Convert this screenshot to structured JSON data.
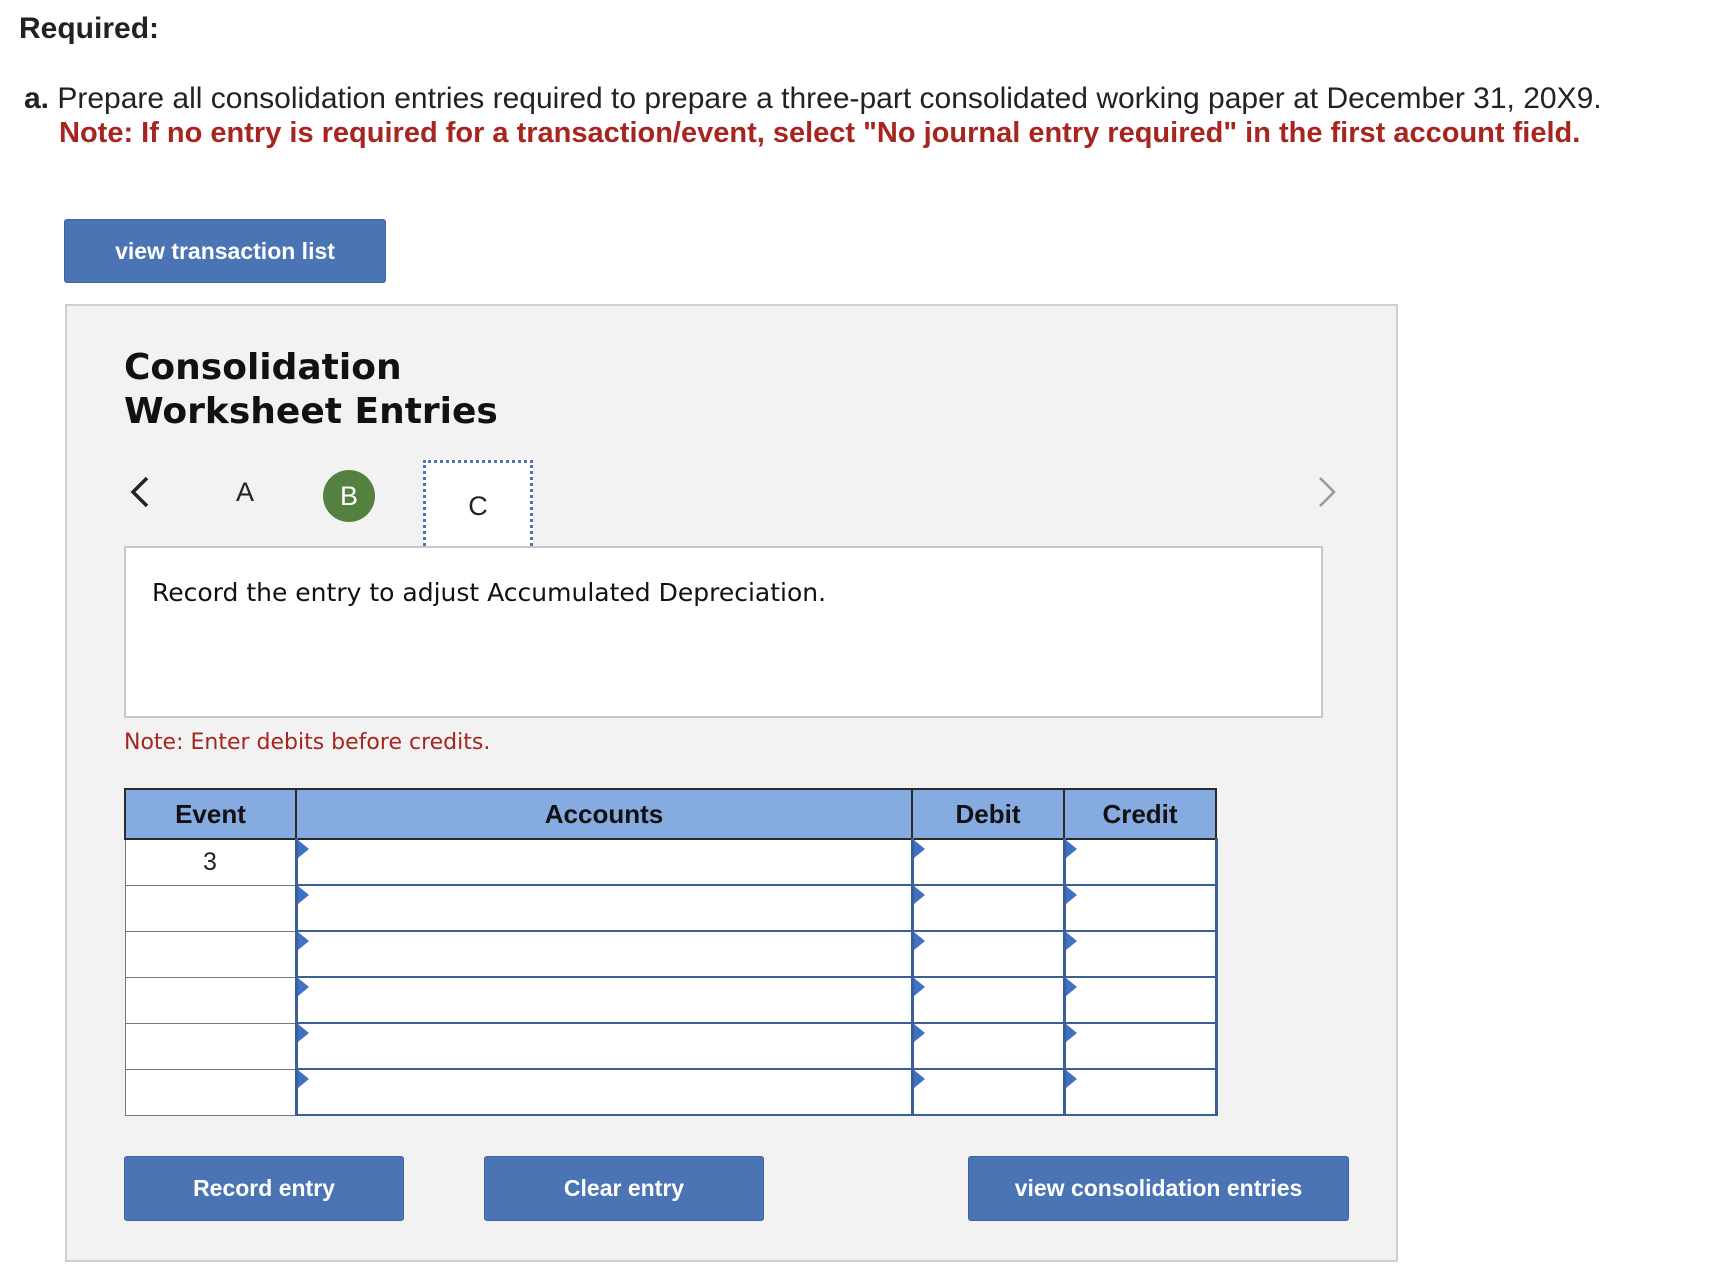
{
  "header": {
    "required": "Required:",
    "question_letter": "a.",
    "question_text": " Prepare all consolidation entries required to prepare a three-part consolidated working paper at December 31, 20X9.",
    "note": "Note: If no entry is required for a transaction/event, select \"No journal entry required\" in the first account field."
  },
  "buttons": {
    "view_transaction_list": "view transaction list",
    "record_entry": "Record entry",
    "clear_entry": "Clear entry",
    "view_consolidation_entries": "view consolidation entries"
  },
  "panel": {
    "title_line1": "Consolidation",
    "title_line2": "Worksheet Entries",
    "tabs": [
      {
        "label": "A",
        "state": "default"
      },
      {
        "label": "B",
        "state": "completed"
      },
      {
        "label": "C",
        "state": "active"
      }
    ],
    "prompt": "Record the entry to adjust Accumulated Depreciation.",
    "note": "Note: Enter debits before credits."
  },
  "journal_table": {
    "headers": [
      "Event",
      "Accounts",
      "Debit",
      "Credit"
    ],
    "rows": [
      {
        "event": "3",
        "account": "",
        "debit": "",
        "credit": ""
      },
      {
        "event": "",
        "account": "",
        "debit": "",
        "credit": ""
      },
      {
        "event": "",
        "account": "",
        "debit": "",
        "credit": ""
      },
      {
        "event": "",
        "account": "",
        "debit": "",
        "credit": ""
      },
      {
        "event": "",
        "account": "",
        "debit": "",
        "credit": ""
      },
      {
        "event": "",
        "account": "",
        "debit": "",
        "credit": ""
      }
    ]
  },
  "colors": {
    "button_blue": "#4a74b4",
    "header_blue": "#85abe0",
    "note_red": "#a6251f",
    "tab_completed_green": "#548040",
    "panel_gray": "#f2f2f2"
  }
}
